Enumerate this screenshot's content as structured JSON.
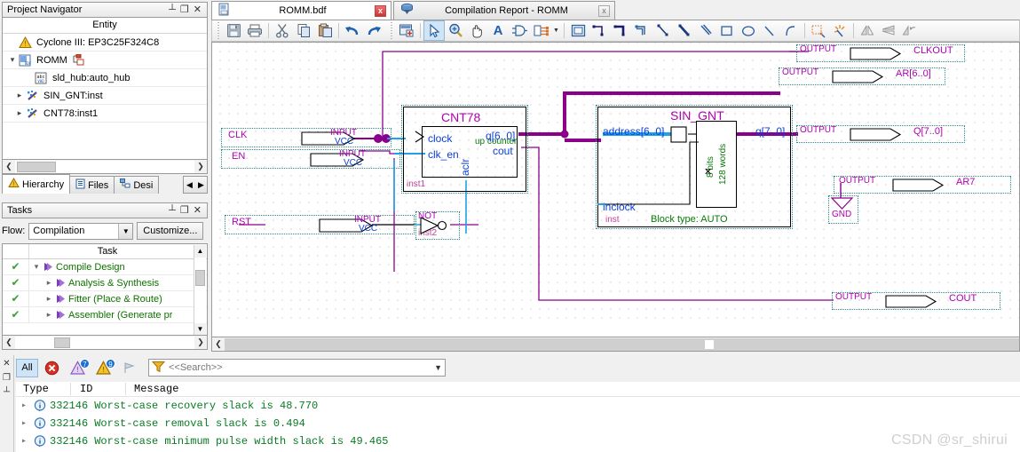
{
  "project_navigator": {
    "title": "Project Navigator",
    "window_buttons": [
      "pin-icon",
      "restore-icon",
      "close-icon"
    ],
    "column_header": "Entity",
    "items": [
      {
        "label": "Cyclone III: EP3C25F324C8",
        "icon": "device-warning-icon",
        "indent": 0,
        "twisty": ""
      },
      {
        "label": "ROMM",
        "icon": "bdf-file-icon",
        "indent": 0,
        "twisty": "expanded",
        "badge": "hierarchy-icon"
      },
      {
        "label": "sld_hub:auto_hub",
        "icon": "vhdl-file-icon",
        "indent": 1,
        "twisty": ""
      },
      {
        "label": "SIN_GNT:inst",
        "icon": "megafunction-icon",
        "indent": 1,
        "twisty": "collapsed"
      },
      {
        "label": "CNT78:inst1",
        "icon": "megafunction-icon",
        "indent": 1,
        "twisty": "collapsed"
      }
    ],
    "tabs": [
      {
        "label": "Hierarchy",
        "icon": "hierarchy-warning-icon",
        "active": true
      },
      {
        "label": "Files",
        "icon": "files-icon",
        "active": false
      },
      {
        "label": "Desi",
        "icon": "design-units-icon",
        "active": false
      }
    ]
  },
  "tasks": {
    "title": "Tasks",
    "window_buttons": [
      "pin-icon",
      "restore-icon",
      "close-icon"
    ],
    "flow_label": "Flow:",
    "flow_value": "Compilation",
    "customize_label": "Customize...",
    "column_header": "Task",
    "rows": [
      {
        "check": "done",
        "twisty": "expanded",
        "label": "Compile Design",
        "indent": 0
      },
      {
        "check": "done",
        "twisty": "collapsed",
        "label": "Analysis & Synthesis",
        "indent": 1
      },
      {
        "check": "done",
        "twisty": "collapsed",
        "label": "Fitter (Place & Route)",
        "indent": 1
      },
      {
        "check": "done",
        "twisty": "collapsed",
        "label": "Assembler (Generate pr",
        "indent": 1
      }
    ]
  },
  "editor": {
    "tabs": [
      {
        "label": "ROMM.bdf",
        "icon": "bdf-doc-icon",
        "active": true,
        "close": "x"
      },
      {
        "label": "Compilation Report - ROMM",
        "icon": "compilation-report-icon",
        "active": false,
        "close": "x"
      }
    ],
    "toolbar": [
      {
        "name": "save-icon",
        "glyph": "save"
      },
      {
        "name": "print-icon",
        "glyph": "print"
      },
      {
        "name": "cut-icon",
        "glyph": "cut"
      },
      {
        "name": "copy-icon",
        "glyph": "copy"
      },
      {
        "name": "paste-icon",
        "glyph": "paste"
      },
      {
        "name": "undo-icon",
        "glyph": "undo"
      },
      {
        "name": "redo-icon",
        "glyph": "redo"
      },
      {
        "name": "analyze-file-icon",
        "glyph": "analyze"
      },
      {
        "name": "select-tool-icon",
        "glyph": "arrow",
        "selected": true
      },
      {
        "name": "zoom-tool-icon",
        "glyph": "zoom"
      },
      {
        "name": "hand-tool-icon",
        "glyph": "hand"
      },
      {
        "name": "text-tool-icon",
        "glyph": "A"
      },
      {
        "name": "symbol-tool-icon",
        "glyph": "gate"
      },
      {
        "name": "block-tool-icon",
        "glyph": "block"
      },
      {
        "name": "block-dropdown-caret-icon",
        "glyph": "caret"
      },
      {
        "name": "rectangle-tool-icon",
        "glyph": "rect"
      },
      {
        "name": "orthogonal-node-tool-icon",
        "glyph": "node1"
      },
      {
        "name": "orthogonal-bus-tool-icon",
        "glyph": "node2"
      },
      {
        "name": "orthogonal-conduit-tool-icon",
        "glyph": "node3"
      },
      {
        "name": "diagonal-node-tool-icon",
        "glyph": "diag1"
      },
      {
        "name": "diagonal-bus-tool-icon",
        "glyph": "diag2"
      },
      {
        "name": "diagonal-conduit-tool-icon",
        "glyph": "diag3"
      },
      {
        "name": "draw-rectangle-icon",
        "glyph": "rect2"
      },
      {
        "name": "draw-oval-icon",
        "glyph": "oval"
      },
      {
        "name": "draw-line-icon",
        "glyph": "line"
      },
      {
        "name": "draw-arc-icon",
        "glyph": "arc"
      },
      {
        "name": "rubberbanding-icon",
        "glyph": "rubber"
      },
      {
        "name": "partial-rubberbanding-icon",
        "glyph": "rubber2"
      },
      {
        "name": "flip-horizontal-icon",
        "glyph": "fliph"
      },
      {
        "name": "flip-vertical-icon",
        "glyph": "flipv"
      },
      {
        "name": "rotate-left-icon",
        "glyph": "rotate"
      }
    ]
  },
  "schematic": {
    "input_pins": [
      {
        "name": "CLK",
        "type": "INPUT",
        "default": "VCC"
      },
      {
        "name": "EN",
        "type": "INPUT",
        "default": "VCC"
      },
      {
        "name": "RST",
        "type": "INPUT",
        "default": "VCC"
      }
    ],
    "output_pins": [
      {
        "name": "CLKOUT",
        "type": "OUTPUT"
      },
      {
        "name": "AR[6..0]",
        "type": "OUTPUT"
      },
      {
        "name": "Q[7..0]",
        "type": "OUTPUT"
      },
      {
        "name": "AR7",
        "type": "OUTPUT"
      },
      {
        "name": "COUT",
        "type": "OUTPUT"
      }
    ],
    "gnd_label": "GND",
    "not_gate": {
      "type": "NOT",
      "instance": "inst2"
    },
    "blocks": [
      {
        "title": "CNT78",
        "instance": "inst1",
        "inner_label": "up counter",
        "inputs": [
          "clock",
          "clk_en"
        ],
        "bottom_input": "aclr",
        "outputs": [
          "q[6..0]",
          "cout"
        ]
      },
      {
        "title": "SIN_GNT",
        "instance": "inst",
        "block_type": "Block type: AUTO",
        "inputs": [
          "address[6..0]",
          "inclock"
        ],
        "outputs": [
          "q[7..0]"
        ],
        "rom_line1": "8 bits",
        "rom_line2": "128 words"
      }
    ]
  },
  "messages": {
    "filter_buttons": [
      {
        "label": "All",
        "name": "all-messages-button",
        "active": true
      },
      {
        "label": "",
        "name": "error-filter-icon",
        "icon": "error-icon"
      },
      {
        "label": "",
        "name": "critical-warning-filter-icon",
        "icon": "critical-warning-icon",
        "badge": "7"
      },
      {
        "label": "",
        "name": "warning-filter-icon",
        "icon": "warning-icon",
        "badge": "9"
      },
      {
        "label": "",
        "name": "info-filter-icon",
        "icon": "flag-icon"
      }
    ],
    "search_placeholder": "<<Search>>",
    "columns": [
      "Type",
      "ID",
      "Message"
    ],
    "rows": [
      {
        "type": "info",
        "id": "332146",
        "text": "Worst-case recovery slack is 48.770"
      },
      {
        "type": "info",
        "id": "332146",
        "text": "Worst-case removal slack is 0.494"
      },
      {
        "type": "info",
        "id": "332146",
        "text": "Worst-case minimum pulse width slack is 49.465"
      }
    ]
  },
  "watermark": "CSDN @sr_shirui",
  "colors": {
    "wire_magenta": "#8b008b",
    "wire_blue": "#1ea2e8",
    "label_magenta": "#b000b0",
    "label_blue": "#0b3fd8",
    "label_green": "#0a7a0a",
    "selection_dotted": "#2e8b8b"
  }
}
